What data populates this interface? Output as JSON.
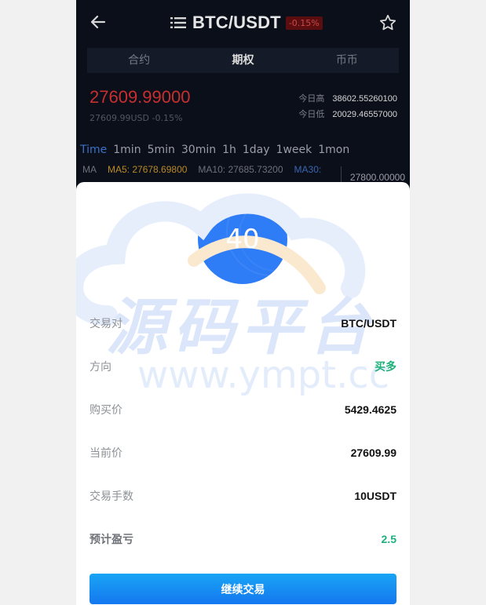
{
  "header": {
    "title": "BTC/USDT",
    "change_badge": "-0.15%"
  },
  "tabs": [
    {
      "label": "合约",
      "active": false
    },
    {
      "label": "期权",
      "active": true
    },
    {
      "label": "币币",
      "active": false
    }
  ],
  "ticker": {
    "price": "27609.99000",
    "sub": "27609.99USD  -0.15%",
    "high_label": "今日高",
    "high_value": "38602.55260100",
    "low_label": "今日低",
    "low_value": "20029.46557000"
  },
  "intervals": [
    "Time",
    "1min",
    "5min",
    "30min",
    "1h",
    "1day",
    "1week",
    "1mon"
  ],
  "active_interval": "Time",
  "ma": {
    "label": "MA",
    "ma5": "MA5: 27678.69800",
    "ma10": "MA10: 27685.73200",
    "ma30": "MA30:"
  },
  "axis_value": "27800.00000",
  "sheet": {
    "countdown": "40",
    "watermark_cn": "源码平台",
    "watermark_url": "www.ympt.cc",
    "rows": [
      {
        "key": "交易对",
        "value": "BTC/USDT"
      },
      {
        "key": "方向",
        "value": "买多"
      },
      {
        "key": "购买价",
        "value": "5429.4625"
      },
      {
        "key": "当前价",
        "value": "27609.99"
      },
      {
        "key": "交易手数",
        "value": "10USDT"
      },
      {
        "key": "预计盈亏",
        "value": "2.5"
      }
    ],
    "continue_label": "继续交易"
  },
  "colors": {
    "accent": "#2e7cf6",
    "profit_green": "#1eb07c",
    "loss_red": "#c8302f"
  }
}
